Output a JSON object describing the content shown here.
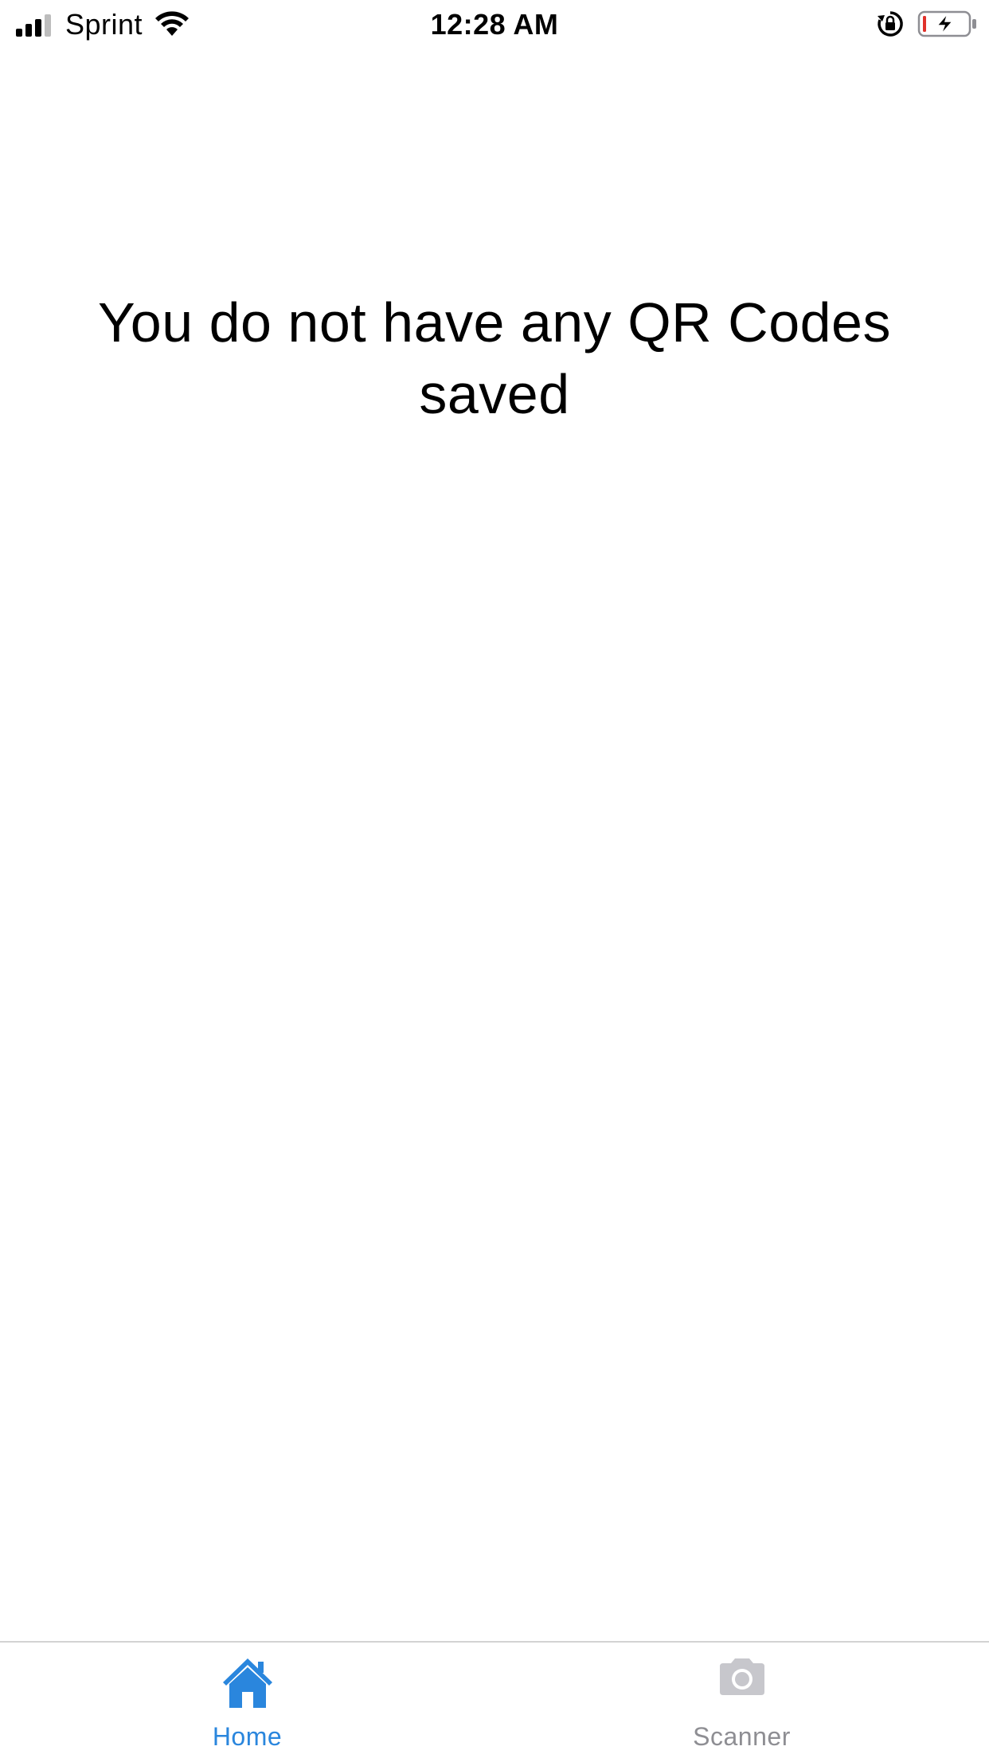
{
  "status_bar": {
    "carrier": "Sprint",
    "time": "12:28 AM",
    "signal_bars_filled": 3,
    "signal_bars_total": 4,
    "battery_level": 0.05,
    "charging": true,
    "battery_low_color": "#e0312b"
  },
  "main": {
    "empty_message": "You do not have any QR Codes saved"
  },
  "tab_bar": {
    "active_color": "#2a86dd",
    "inactive_color": "#c7c7cc",
    "tabs": [
      {
        "label": "Home",
        "icon": "home-icon",
        "active": true
      },
      {
        "label": "Scanner",
        "icon": "camera-icon",
        "active": false
      }
    ]
  }
}
